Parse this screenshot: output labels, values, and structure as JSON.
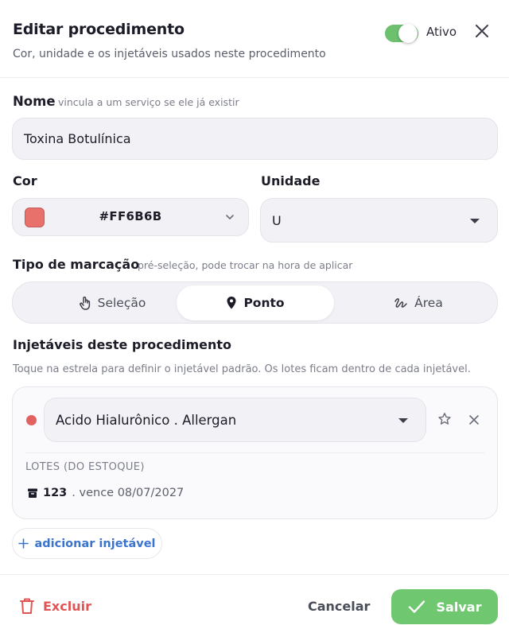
{
  "header": {
    "title": "Editar procedimento",
    "subtitle": "Cor, unidade e os injetáveis usados neste procedimento",
    "active_label": "Ativo",
    "active": true
  },
  "name_field": {
    "label": "Nome",
    "hint": "vincula a um serviço se ele já existir",
    "value": "Toxina Botulínica"
  },
  "color_field": {
    "label": "Cor",
    "value": "#FF6B6B",
    "swatch_color": "#E8716B"
  },
  "unit_field": {
    "label": "Unidade",
    "value": "U"
  },
  "marking_type": {
    "label": "Tipo de marcação",
    "hint": "pré-seleção, pode trocar na hora de aplicar",
    "options": [
      {
        "label": "Seleção",
        "icon": "hand-pointer-icon"
      },
      {
        "label": "Ponto",
        "icon": "map-pin-icon"
      },
      {
        "label": "Área",
        "icon": "scribble-icon"
      }
    ],
    "selected": "Ponto"
  },
  "injectables": {
    "title": "Injetáveis deste procedimento",
    "hint": "Toque na estrela para definir o injetável padrão. Os lotes ficam dentro de cada injetável.",
    "items": [
      {
        "name": "Acido Hialurônico . Allergan",
        "dot_color": "#E26161",
        "lots_label": "LOTES (DO ESTOQUE)",
        "lots": [
          {
            "number": "123",
            "expiry": ". vence 08/07/2027"
          }
        ]
      }
    ],
    "add_label": "adicionar injetável"
  },
  "footer": {
    "delete_label": "Excluir",
    "cancel_label": "Cancelar",
    "save_label": "Salvar"
  },
  "colors": {
    "accent_green": "#6FC870",
    "danger_red": "#E05555",
    "link_blue": "#3A74CF"
  }
}
